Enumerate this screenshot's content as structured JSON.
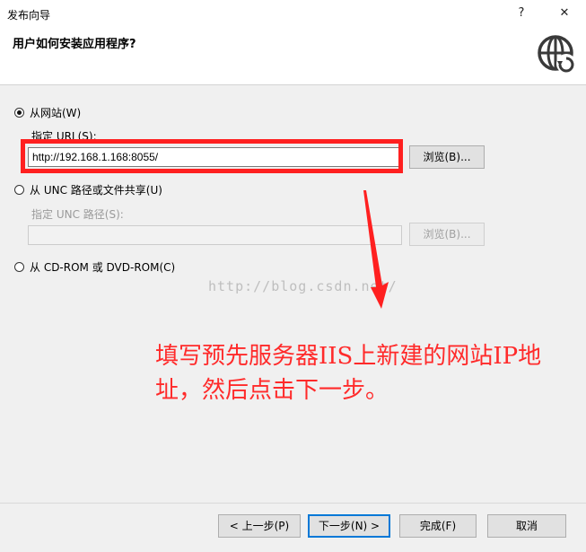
{
  "window": {
    "title": "发布向导",
    "help_glyph": "?",
    "close_glyph": "✕"
  },
  "header": {
    "title": "用户如何安装应用程序?",
    "icon": "globe-icon"
  },
  "options": {
    "website": {
      "label": "从网站(W)",
      "checked": true,
      "url_label": "指定 URL(S):",
      "url_value": "http://192.168.1.168:8055/",
      "browse_label": "浏览(B)..."
    },
    "unc": {
      "label": "从 UNC 路径或文件共享(U)",
      "checked": false,
      "path_label": "指定 UNC 路径(S):",
      "path_value": "",
      "browse_label": "浏览(B)..."
    },
    "cdrom": {
      "label": "从 CD-ROM 或 DVD-ROM(C)",
      "checked": false
    }
  },
  "overlay": {
    "watermark": "http://blog.csdn.net/",
    "annotation": "填写预先服务器IIS上新建的网站IP地址，然后点击下一步。",
    "highlight_color": "#ff2020",
    "annotation_color": "#ff2a2a"
  },
  "footer": {
    "prev_label": "< 上一步(P)",
    "next_label": "下一步(N) >",
    "finish_label": "完成(F)",
    "cancel_label": "取消"
  },
  "colors": {
    "accent": "#0078d7",
    "background": "#f0f0f0"
  }
}
